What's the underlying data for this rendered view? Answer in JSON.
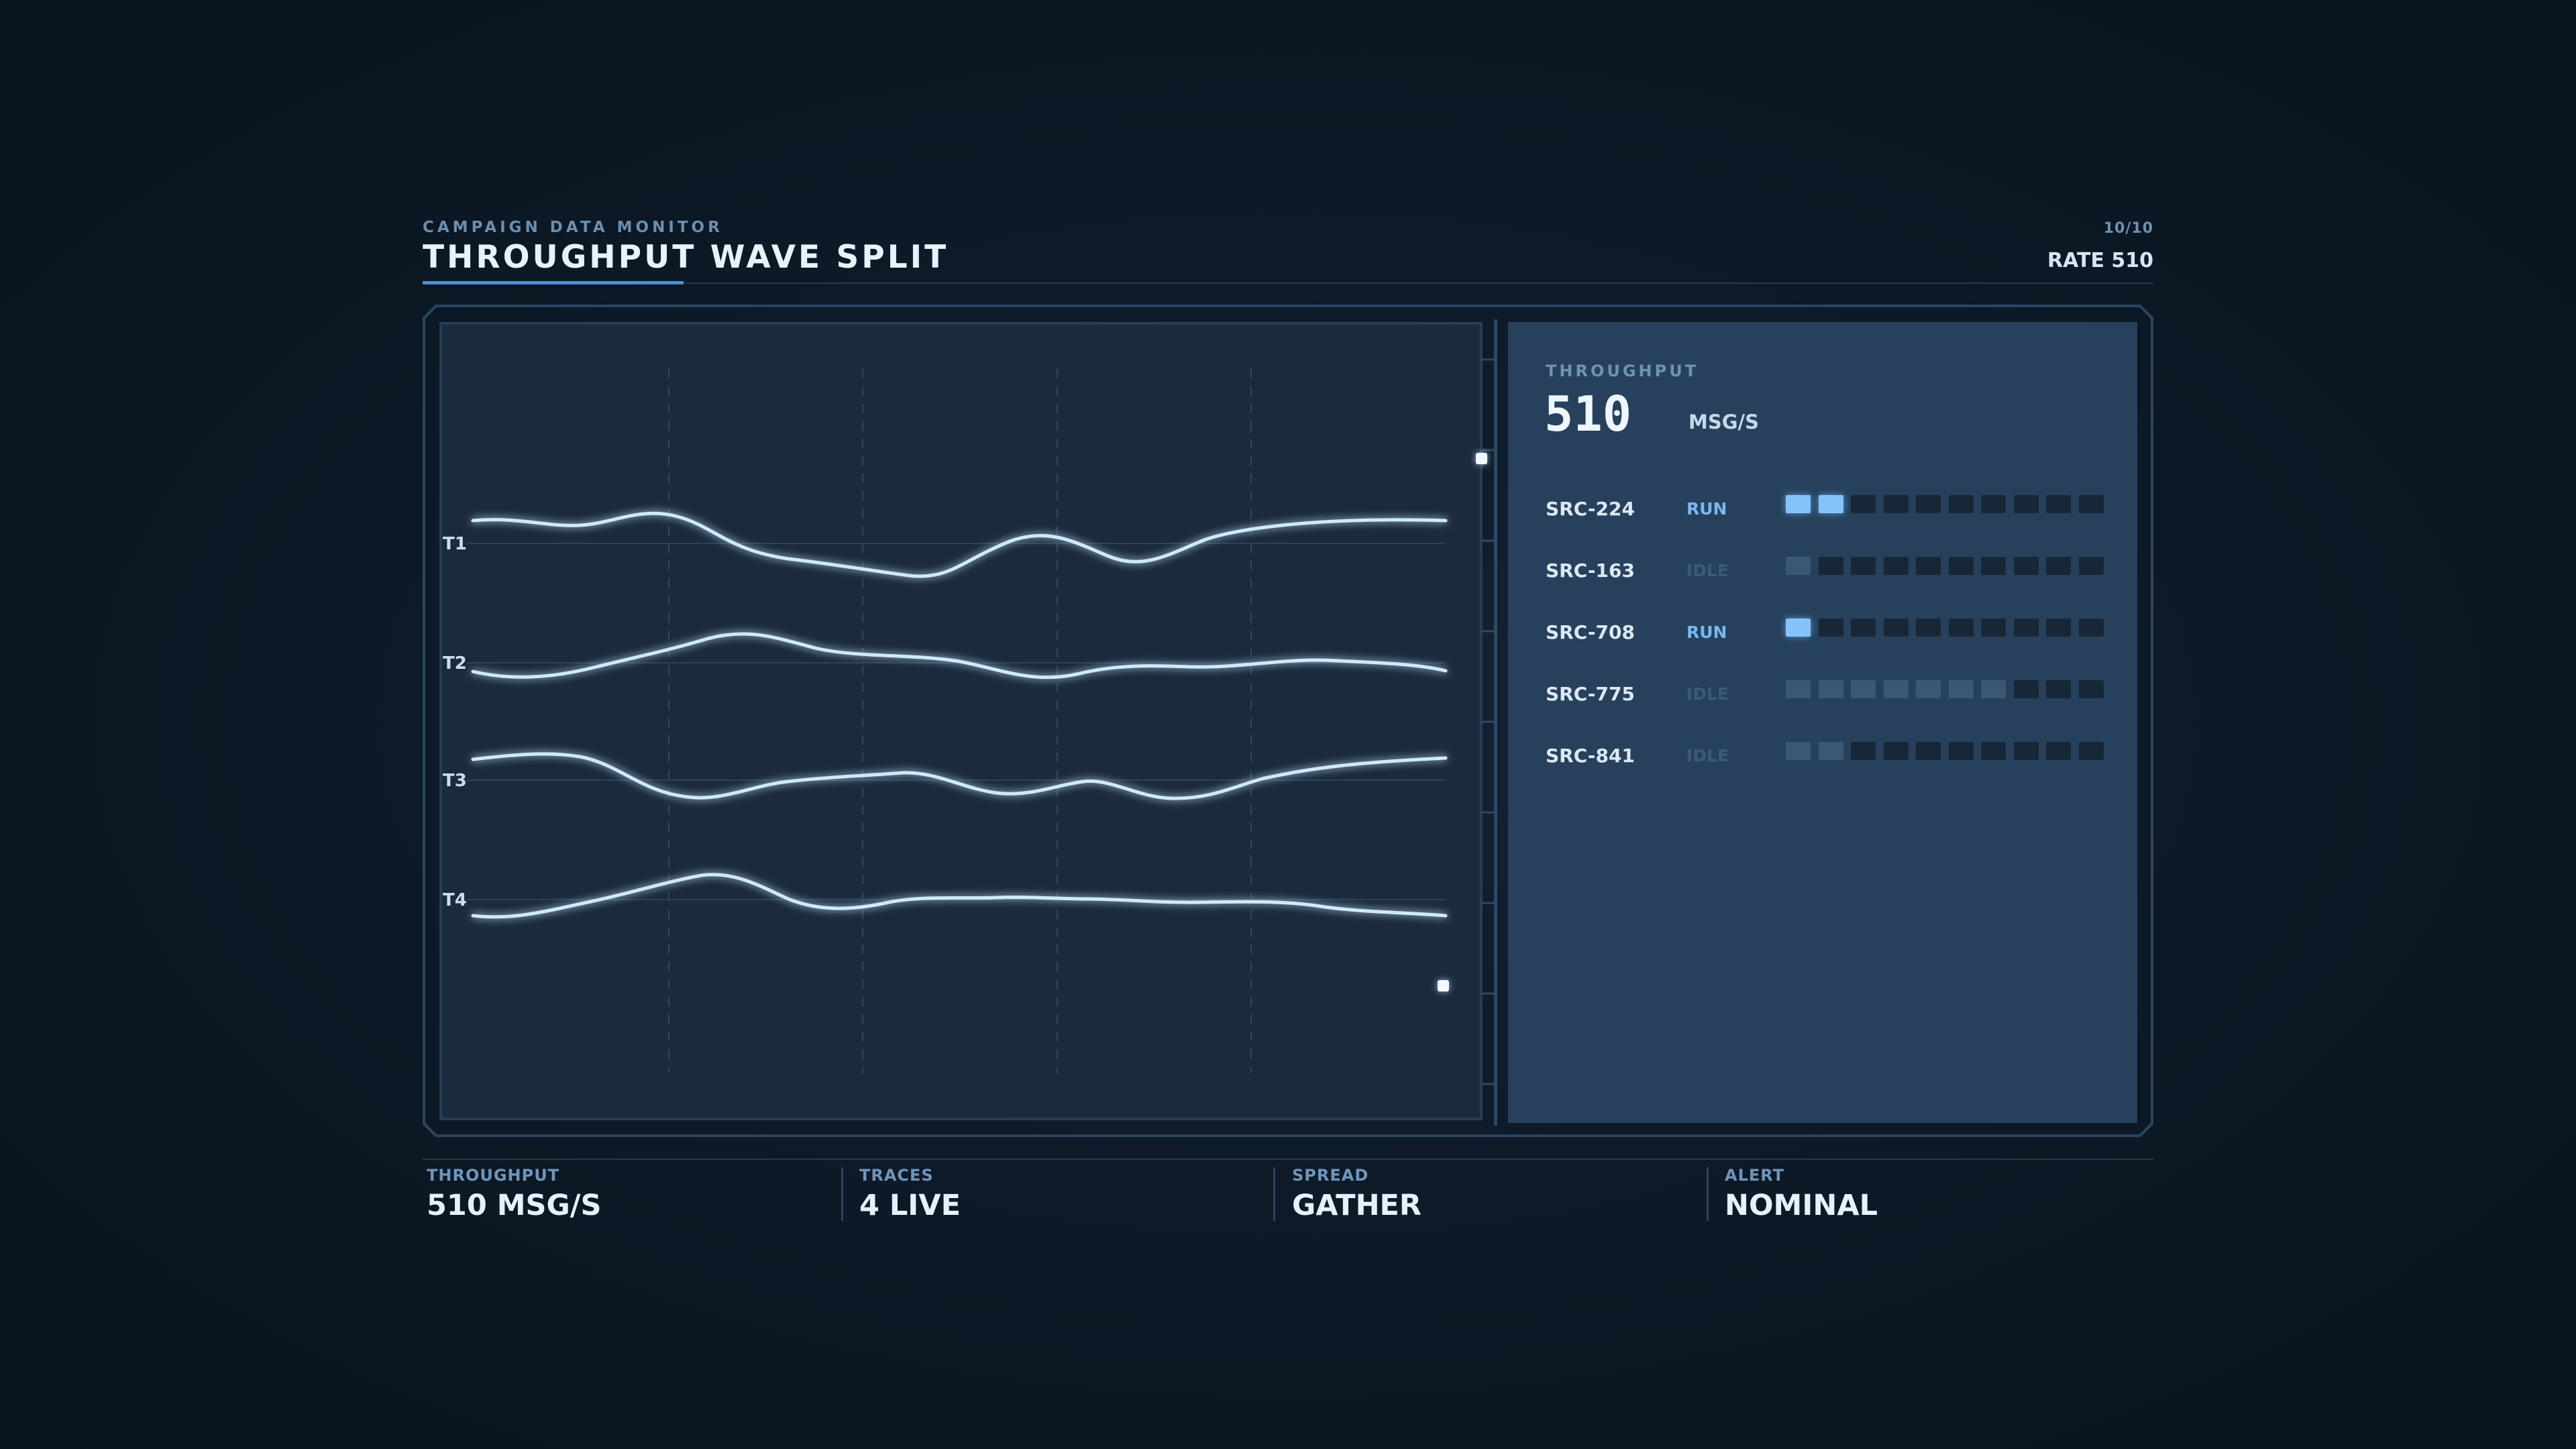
{
  "header": {
    "subtitle": "CAMPAIGN DATA MONITOR",
    "title": "THROUGHPUT WAVE SPLIT",
    "page": "10/10",
    "rate": "RATE 510"
  },
  "waves": {
    "traces": [
      {
        "label": "T1"
      },
      {
        "label": "T2"
      },
      {
        "label": "T3"
      },
      {
        "label": "T4"
      }
    ],
    "colors": {
      "line": "#cfe9ff",
      "glow": "#6fb8ff"
    }
  },
  "side_panel": {
    "label": "THROUGHPUT",
    "value": "510",
    "unit": "MSG/S",
    "sources": [
      {
        "id": "SRC-224",
        "state": "RUN",
        "level": 2
      },
      {
        "id": "SRC-163",
        "state": "IDLE",
        "level": 1
      },
      {
        "id": "SRC-708",
        "state": "RUN",
        "level": 1
      },
      {
        "id": "SRC-775",
        "state": "IDLE",
        "level": 7
      },
      {
        "id": "SRC-841",
        "state": "IDLE",
        "level": 2
      }
    ],
    "cells_per_source": 10
  },
  "footer": [
    {
      "label": "THROUGHPUT",
      "value": "510 MSG/S"
    },
    {
      "label": "TRACES",
      "value": "4 LIVE"
    },
    {
      "label": "SPREAD",
      "value": "GATHER"
    },
    {
      "label": "ALERT",
      "value": "NOMINAL"
    }
  ],
  "colors": {
    "accent": "#4a90d9",
    "run": "#86c3fb",
    "idle": "#3b5774",
    "panel": "#27415c"
  }
}
